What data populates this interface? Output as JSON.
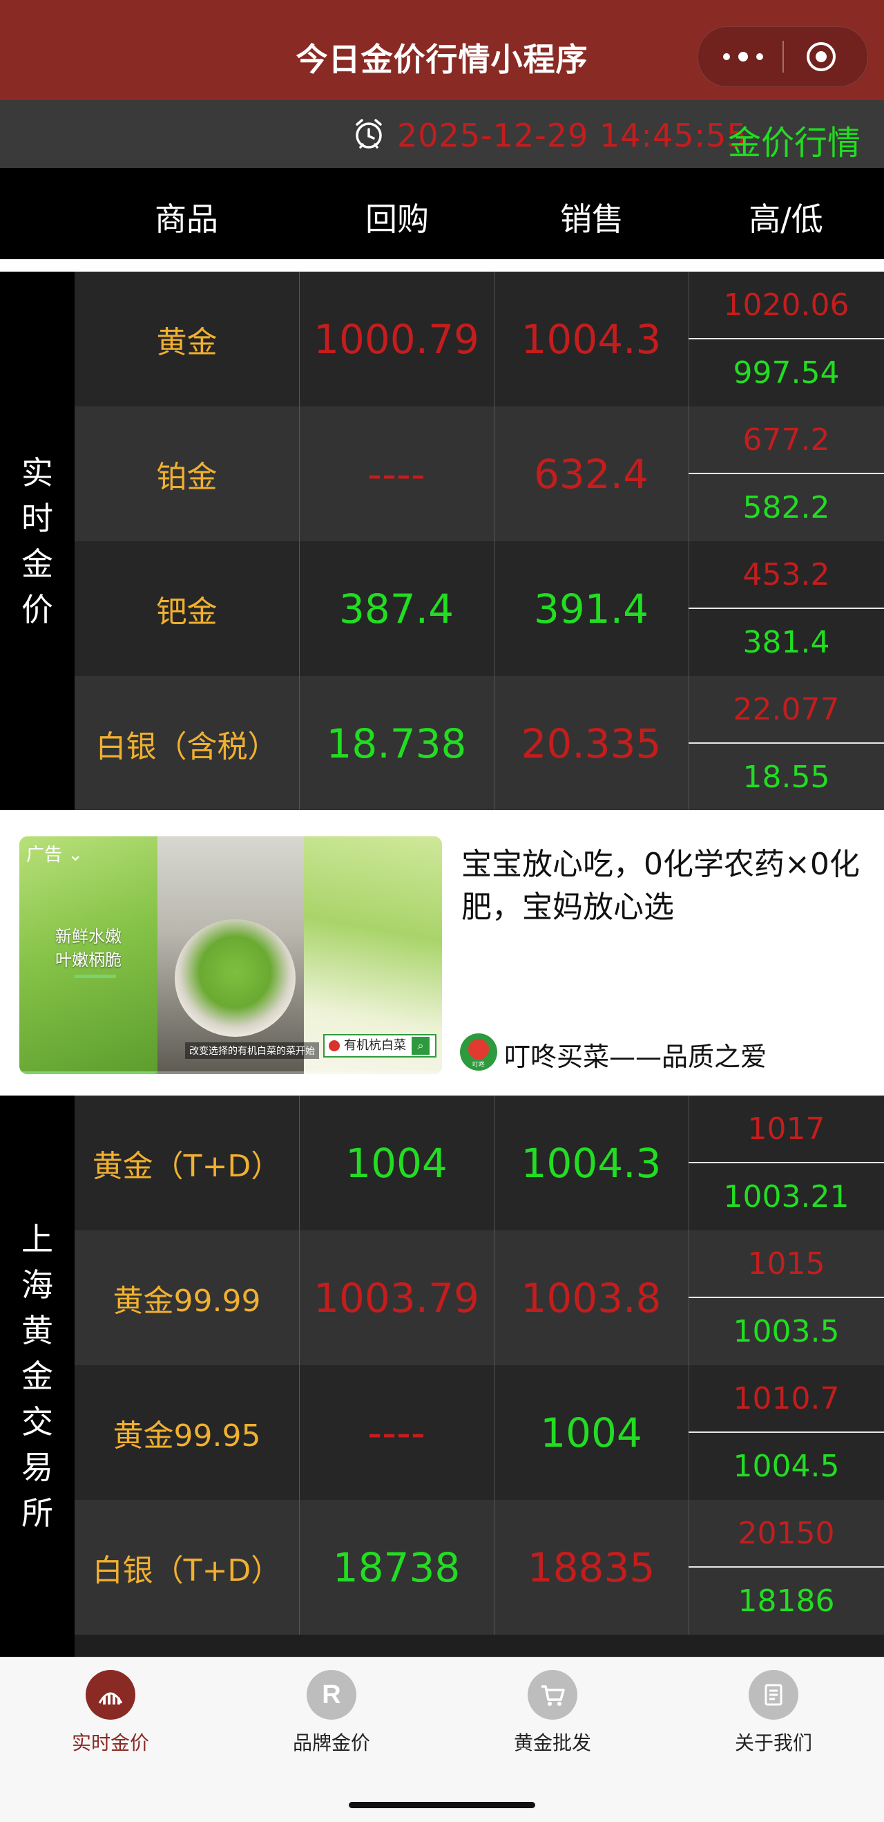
{
  "app": {
    "title": "今日金价行情小程序"
  },
  "timebar": {
    "datetime": "2025-12-29 14:45:55",
    "link": "金价行情"
  },
  "columns": [
    "商品",
    "回购",
    "销售",
    "高/低"
  ],
  "realtime": {
    "side_label": [
      "实",
      "时",
      "金",
      "价"
    ],
    "rows": [
      {
        "name": "黄金",
        "buy": "1000.79",
        "buy_color": "#c41d1d",
        "sell": "1004.3",
        "sell_color": "#c41d1d",
        "high": "1020.06",
        "low": "997.54"
      },
      {
        "name": "铂金",
        "buy": "----",
        "buy_color": "#c41d1d",
        "sell": "632.4",
        "sell_color": "#c41d1d",
        "high": "677.2",
        "low": "582.2"
      },
      {
        "name": "钯金",
        "buy": "387.4",
        "buy_color": "#22dd22",
        "sell": "391.4",
        "sell_color": "#22dd22",
        "high": "453.2",
        "low": "381.4"
      },
      {
        "name": "白银（含税）",
        "buy": "18.738",
        "buy_color": "#22dd22",
        "sell": "20.335",
        "sell_color": "#c41d1d",
        "high": "22.077",
        "low": "18.55"
      }
    ]
  },
  "ad": {
    "tag": "广告",
    "image_caption_line1": "新鲜水嫩",
    "image_caption_line2": "叶嫩柄脆",
    "image_subcaption": "改变选择的有机白菜的菜开始",
    "image_badge": "有机杭白菜",
    "title": "宝宝放心吃，0化学农药×0化肥，宝妈放心选",
    "logo_text": "叮咚",
    "brand": "叮咚买菜——品质之爱"
  },
  "shanghai": {
    "side_label": [
      "上",
      "海",
      "黄",
      "金",
      "交",
      "易",
      "所"
    ],
    "rows": [
      {
        "name": "黄金（T+D）",
        "buy": "1004",
        "buy_color": "#22dd22",
        "sell": "1004.3",
        "sell_color": "#22dd22",
        "high": "1017",
        "low": "1003.21"
      },
      {
        "name": "黄金99.99",
        "buy": "1003.79",
        "buy_color": "#c41d1d",
        "sell": "1003.8",
        "sell_color": "#c41d1d",
        "high": "1015",
        "low": "1003.5"
      },
      {
        "name": "黄金99.95",
        "buy": "----",
        "buy_color": "#c41d1d",
        "sell": "1004",
        "sell_color": "#22dd22",
        "high": "1010.7",
        "low": "1004.5"
      },
      {
        "name": "白银（T+D）",
        "buy": "18738",
        "buy_color": "#22dd22",
        "sell": "18835",
        "sell_color": "#c41d1d",
        "high": "20150",
        "low": "18186"
      }
    ]
  },
  "tabbar": {
    "items": [
      {
        "label": "实时金价",
        "icon": "chart-icon",
        "active": true
      },
      {
        "label": "品牌金价",
        "icon": "brand-r-icon",
        "active": false
      },
      {
        "label": "黄金批发",
        "icon": "cart-icon",
        "active": false
      },
      {
        "label": "关于我们",
        "icon": "document-icon",
        "active": false
      }
    ]
  }
}
